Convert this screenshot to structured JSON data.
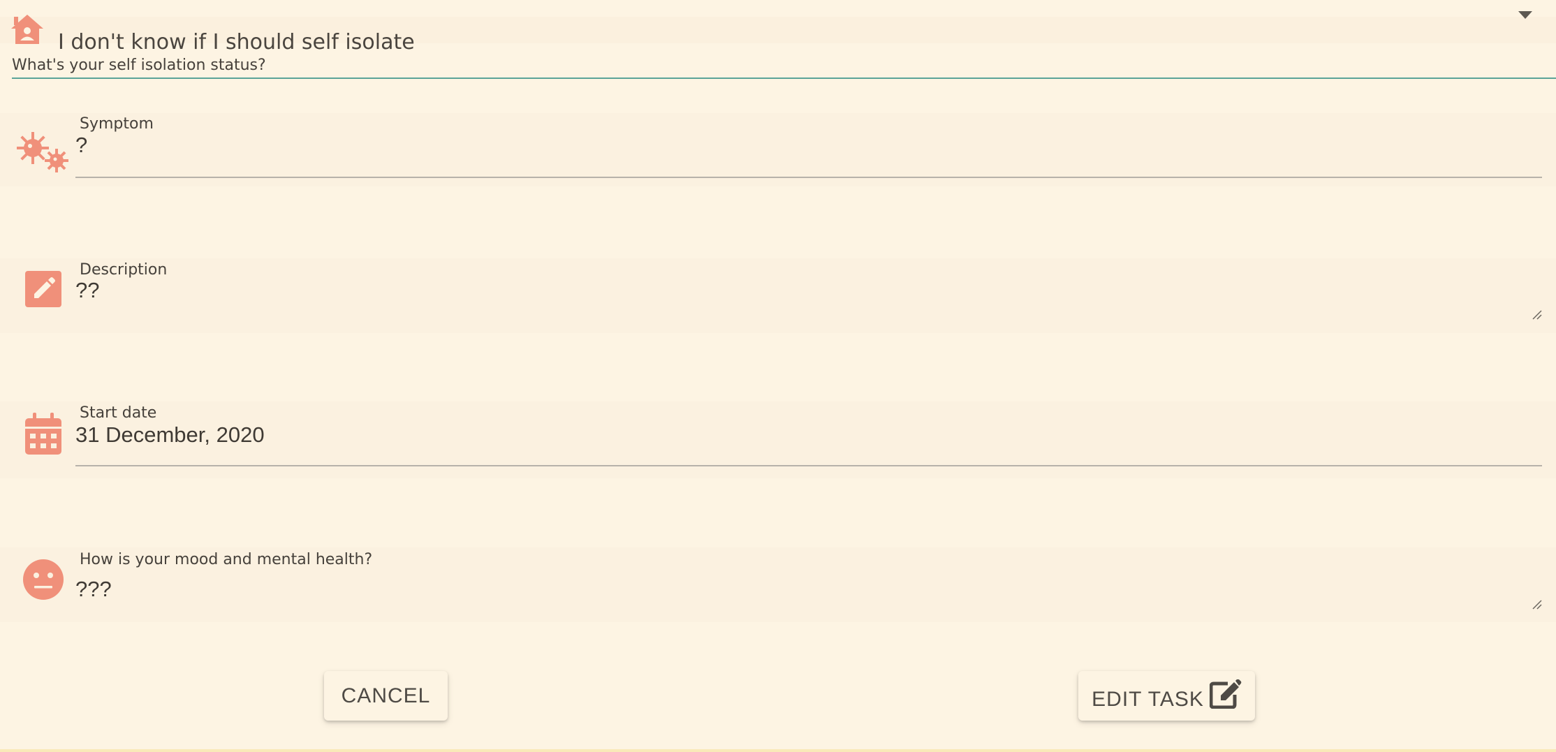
{
  "status": {
    "value": "I don't know if I should self isolate",
    "label": "What's your self isolation status?",
    "icon": "home-person-icon"
  },
  "symptom": {
    "label": "Symptom",
    "value": "?",
    "icon": "virus-icon"
  },
  "description": {
    "label": "Description",
    "value": "??",
    "icon": "edit-icon"
  },
  "start_date": {
    "label": "Start date",
    "value": "31 December, 2020",
    "icon": "calendar-icon"
  },
  "mood": {
    "label": "How is your mood and mental health?",
    "value": "???",
    "icon": "neutral-face-icon"
  },
  "actions": {
    "cancel_label": "CANCEL",
    "edit_label": "EDIT TASK",
    "edit_icon": "edit-square-icon"
  },
  "colors": {
    "background": "#fdf4e3",
    "field_bg": "#fbf1e0",
    "accent": "#f0907a",
    "focus_underline": "#5aa398"
  }
}
